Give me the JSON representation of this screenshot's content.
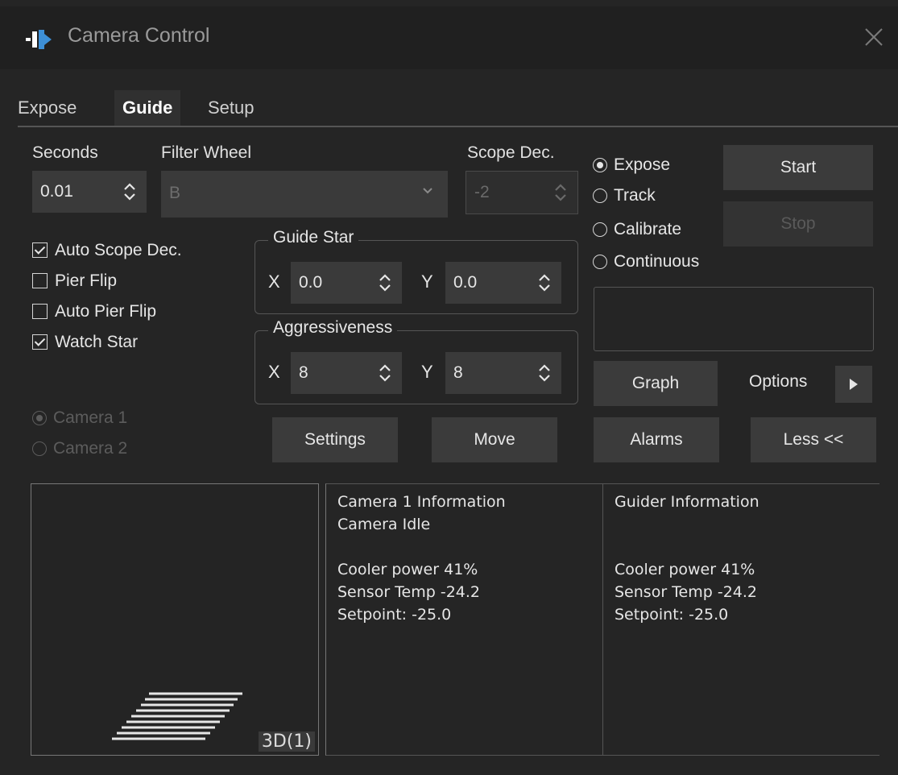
{
  "window": {
    "title": "Camera Control"
  },
  "tabs": [
    {
      "label": "Expose",
      "active": false
    },
    {
      "label": "Guide",
      "active": true
    },
    {
      "label": "Setup",
      "active": false
    }
  ],
  "seconds": {
    "label": "Seconds",
    "value": "0.01"
  },
  "filter_wheel": {
    "label": "Filter Wheel",
    "value": "B"
  },
  "scope_dec": {
    "label": "Scope Dec.",
    "value": "-2"
  },
  "mode_radios": [
    {
      "label": "Expose",
      "selected": true
    },
    {
      "label": "Track",
      "selected": false
    },
    {
      "label": "Calibrate",
      "selected": false
    },
    {
      "label": "Continuous",
      "selected": false
    }
  ],
  "buttons": {
    "start": "Start",
    "stop": "Stop",
    "graph": "Graph",
    "options": "Options",
    "settings": "Settings",
    "move": "Move",
    "alarms": "Alarms",
    "less": "Less <<"
  },
  "checkboxes": [
    {
      "label": "Auto Scope Dec.",
      "checked": true
    },
    {
      "label": "Pier Flip",
      "checked": false
    },
    {
      "label": "Auto Pier Flip",
      "checked": false
    },
    {
      "label": "Watch Star",
      "checked": true
    }
  ],
  "guide_star": {
    "title": "Guide Star",
    "x_label": "X",
    "x": "0.0",
    "y_label": "Y",
    "y": "0.0"
  },
  "aggressiveness": {
    "title": "Aggressiveness",
    "x_label": "X",
    "x": "8",
    "y_label": "Y",
    "y": "8"
  },
  "camera_radios": [
    {
      "label": "Camera 1",
      "selected": true
    },
    {
      "label": "Camera 2",
      "selected": false
    }
  ],
  "preview": {
    "badge": "3D(1)"
  },
  "camera_info": {
    "title": "Camera 1 Information",
    "status": "Camera Idle",
    "cooler": "Cooler power 41%",
    "sensor": "Sensor Temp -24.2",
    "setpoint": "Setpoint: -25.0"
  },
  "guider_info": {
    "title": "Guider Information",
    "cooler": "Cooler power 41%",
    "sensor": "Sensor Temp -24.2",
    "setpoint": "Setpoint: -25.0"
  },
  "colors": {
    "background": "#252525",
    "button": "#3b3b3b",
    "field": "#3a3a3a",
    "accent_icon": "#3d8fd6"
  }
}
